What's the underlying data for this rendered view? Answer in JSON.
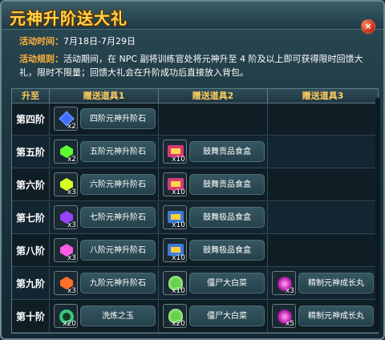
{
  "title": "元神升阶送大礼",
  "close_label": "×",
  "event_time": {
    "label": "活动时间：",
    "value": "7月18日-7月29日"
  },
  "rules": {
    "label": "活动规则：",
    "value": "活动期间，在 NPC 副将训练官处将元神升至 4 阶及以上即可获得限时回馈大礼，限时不限量；回馈大礼会在升阶成功后直接放入背包。"
  },
  "table": {
    "headers": [
      "升至",
      "赠送道具1",
      "赠送道具2",
      "赠送道具3"
    ],
    "rows": [
      {
        "tier": "第四阶",
        "items": [
          {
            "icon": "blue-gem-icon",
            "qty": "x2",
            "name": "四阶元神升阶石"
          }
        ]
      },
      {
        "tier": "第五阶",
        "items": [
          {
            "icon": "green-gem-icon",
            "qty": "x2",
            "name": "五阶元神升阶石"
          },
          {
            "icon": "red-food-box-icon",
            "qty": "x10",
            "name": "鼓舞贡品食盒"
          }
        ]
      },
      {
        "tier": "第六阶",
        "items": [
          {
            "icon": "yellow-gem-icon",
            "qty": "x3",
            "name": "六阶元神升阶石"
          },
          {
            "icon": "red-food-box-icon",
            "qty": "x10",
            "name": "鼓舞贡品食盒"
          }
        ]
      },
      {
        "tier": "第七阶",
        "items": [
          {
            "icon": "purple-gem-icon",
            "qty": "x3",
            "name": "七阶元神升阶石"
          },
          {
            "icon": "blue-food-box-icon",
            "qty": "x10",
            "name": "鼓舞极品食盒"
          }
        ]
      },
      {
        "tier": "第八阶",
        "items": [
          {
            "icon": "pink-gem-icon",
            "qty": "x3",
            "name": "八阶元神升阶石"
          },
          {
            "icon": "blue-food-box-icon",
            "qty": "x10",
            "name": "鼓舞极品食盒"
          }
        ]
      },
      {
        "tier": "第九阶",
        "items": [
          {
            "icon": "orange-gem-icon",
            "qty": "x3",
            "name": "九阶元神升阶石"
          },
          {
            "icon": "cabbage-icon",
            "qty": "x10",
            "name": "僵尸大白菜"
          },
          {
            "icon": "purple-orb-icon",
            "qty": "x3",
            "name": "精制元神成长丸"
          }
        ]
      },
      {
        "tier": "第十阶",
        "items": [
          {
            "icon": "jade-ring-icon",
            "qty": "x20",
            "name": "洗炼之玉"
          },
          {
            "icon": "cabbage-icon",
            "qty": "x20",
            "name": "僵尸大白菜"
          },
          {
            "icon": "purple-orb-icon",
            "qty": "x5",
            "name": "精制元神成长丸"
          }
        ]
      }
    ]
  },
  "colors": {
    "title": "#ffd34a",
    "label": "#ffb33b",
    "header_text": "#ffcf5c",
    "background": "#1d3640"
  }
}
